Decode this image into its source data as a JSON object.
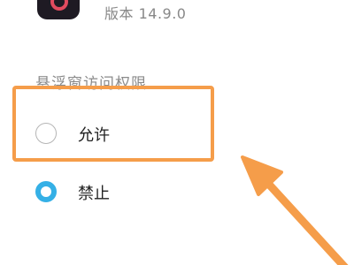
{
  "app": {
    "icon": "tiktok-app-icon",
    "version_text": "版本 14.9.0"
  },
  "permission": {
    "title": "悬浮窗访问权限",
    "options": [
      {
        "label": "允许",
        "selected": false
      },
      {
        "label": "禁止",
        "selected": true
      }
    ]
  },
  "annotation": {
    "color": "#f59d4a",
    "highlights": "允许"
  },
  "colors": {
    "radio_selected": "#35b0e6",
    "radio_unselected_border": "#b5b5b5"
  }
}
